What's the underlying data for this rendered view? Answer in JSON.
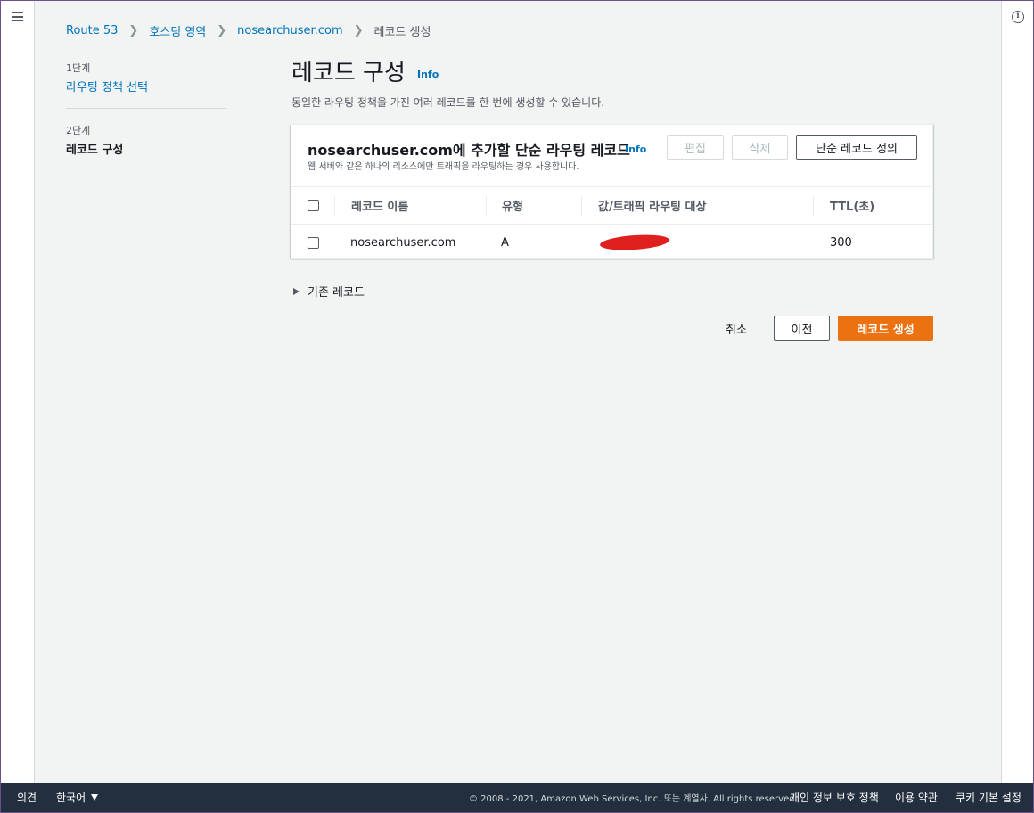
{
  "breadcrumb": [
    "Route 53",
    "호스팅 영역",
    "nosearchuser.com",
    "레코드 생성"
  ],
  "steps": [
    {
      "num": "1단계",
      "label": "라우팅 정책 선택"
    },
    {
      "num": "2단계",
      "label": "레코드 구성"
    }
  ],
  "page": {
    "title": "레코드 구성",
    "info": "Info",
    "description": "동일한 라우팅 정책을 가진 여러 레코드를 한 번에 생성할 수 있습니다."
  },
  "container": {
    "title": "nosearchuser.com에 추가할 단순 라우팅 레코드",
    "info": "Info",
    "description": "웹 서버와 같은 하나의 리소스에만 트래픽을 라우팅하는 경우 사용합니다.",
    "buttons": {
      "edit": "편집",
      "delete": "삭제",
      "define": "단순 레코드 정의"
    }
  },
  "table": {
    "headers": [
      "레코드 이름",
      "유형",
      "값/트래픽 라우팅 대상",
      "TTL(초)"
    ],
    "rows": [
      {
        "name": "nosearchuser.com",
        "type": "A",
        "value": "",
        "ttl": "300"
      }
    ]
  },
  "existing_records": "기존 레코드",
  "actions": {
    "cancel": "취소",
    "previous": "이전",
    "create": "레코드 생성"
  },
  "footer": {
    "feedback": "의견",
    "language": "한국어",
    "copyright": "© 2008 - 2021, Amazon Web Services, Inc. 또는 계열사. All rights reserved.",
    "privacy": "개인 정보 보호 정책",
    "terms": "이용 약관",
    "cookies": "쿠키 기본 설정"
  },
  "colors": {
    "accent": "#ec7211",
    "link": "#0073bb",
    "footer": "#232f3e",
    "redaction": "#e0201f"
  }
}
